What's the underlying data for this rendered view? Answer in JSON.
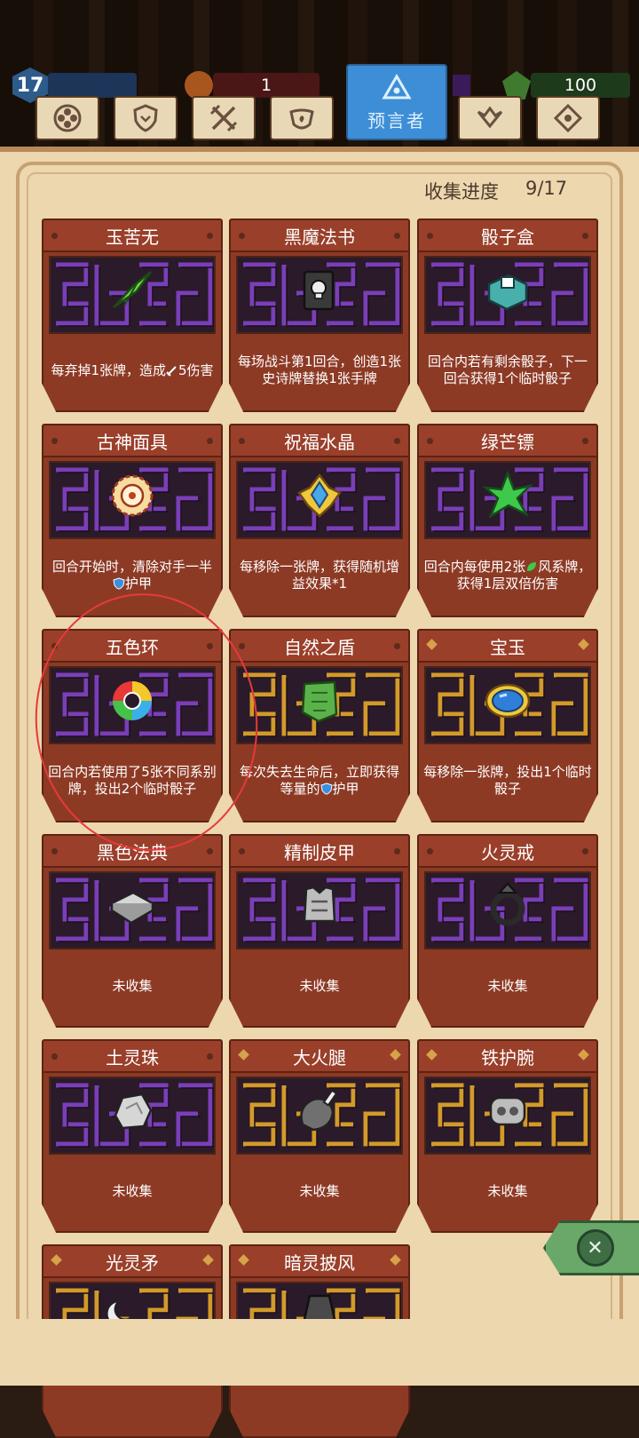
{
  "stats": {
    "level": "17",
    "gold": "1",
    "gems": "100"
  },
  "tabs": [
    {
      "name": "tab-general",
      "icon": "clover-icon"
    },
    {
      "name": "tab-warrior",
      "icon": "shield-icon"
    },
    {
      "name": "tab-ranger",
      "icon": "crossed-swords-icon"
    },
    {
      "name": "tab-mage",
      "icon": "swirl-icon"
    },
    {
      "name": "tab-prophet",
      "label": "预言者",
      "icon": "triangle-eye-icon",
      "active": true
    },
    {
      "name": "tab-beast",
      "icon": "wings-icon"
    },
    {
      "name": "tab-mystic",
      "icon": "diamond-eye-icon"
    }
  ],
  "progress": {
    "label": "收集进度",
    "value": "9/17"
  },
  "cards": [
    {
      "title": "玉苦无",
      "desc_a": "每弃掉1张牌，造成",
      "desc_b": "5",
      "desc_c": "伤害",
      "inline": "sword",
      "maze": "purple",
      "item": "green-kunai",
      "corner": "dot"
    },
    {
      "title": "黑魔法书",
      "desc": "每场战斗第1回合，创造1张史诗牌替换1张手牌",
      "maze": "purple",
      "item": "skull-book",
      "corner": "dot"
    },
    {
      "title": "骰子盒",
      "desc": "回合内若有剩余骰子，下一回合获得1个临时骰子",
      "maze": "purple",
      "item": "dice-box",
      "corner": "dot"
    },
    {
      "title": "古神面具",
      "desc_a": "回合开始时，清除对手一半",
      "desc_b": "",
      "desc_c": "护甲",
      "inline": "shield",
      "maze": "purple",
      "item": "sun-mask",
      "corner": "dot"
    },
    {
      "title": "祝福水晶",
      "desc": "每移除一张牌，获得随机增益效果*1",
      "maze": "purple",
      "item": "blue-crystal",
      "corner": "dot"
    },
    {
      "title": "绿芒镖",
      "desc_a": "回合内每使用2张",
      "desc_b": "",
      "desc_c": "风系牌，获得1层双倍伤害",
      "inline": "leaf",
      "maze": "purple",
      "item": "green-star",
      "corner": "dot"
    },
    {
      "title": "五色环",
      "desc": "回合内若使用了5张不同系别牌，投出2个临时骰子",
      "maze": "purple",
      "item": "rainbow-ring",
      "corner": "dot"
    },
    {
      "title": "自然之盾",
      "desc_a": "每次失去生命后，立即获得等量的",
      "desc_b": "",
      "desc_c": "护甲",
      "inline": "shield",
      "maze": "gold",
      "item": "leaf-shield",
      "corner": "dot"
    },
    {
      "title": "宝玉",
      "desc": "每移除一张牌，投出1个临时骰子",
      "maze": "gold",
      "item": "sapphire",
      "corner": "diamond"
    },
    {
      "title": "黑色法典",
      "desc": "未收集",
      "maze": "purple",
      "item": "grey-book",
      "corner": "dot"
    },
    {
      "title": "精制皮甲",
      "desc": "未收集",
      "maze": "purple",
      "item": "grey-armor",
      "corner": "dot"
    },
    {
      "title": "火灵戒",
      "desc": "未收集",
      "maze": "purple",
      "item": "grey-ring",
      "corner": "dot"
    },
    {
      "title": "土灵珠",
      "desc": "未收集",
      "maze": "purple",
      "item": "grey-orb",
      "corner": "dot"
    },
    {
      "title": "大火腿",
      "desc": "未收集",
      "maze": "gold",
      "item": "grey-ham",
      "corner": "diamond"
    },
    {
      "title": "铁护腕",
      "desc": "未收集",
      "maze": "gold",
      "item": "grey-bracer",
      "corner": "diamond"
    },
    {
      "title": "光灵矛",
      "desc": "",
      "maze": "gold",
      "item": "grey-spear",
      "corner": "diamond"
    },
    {
      "title": "暗灵披风",
      "desc": "",
      "maze": "gold",
      "item": "grey-cloak",
      "corner": "diamond"
    }
  ],
  "colors": {
    "card": "#8d3a25",
    "maze_purple": "#7a3fb8",
    "maze_gold": "#d39a2a",
    "tab_active": "#3d8ed6",
    "parchment": "#ecd7ae"
  },
  "close": {
    "icon": "close-icon"
  }
}
